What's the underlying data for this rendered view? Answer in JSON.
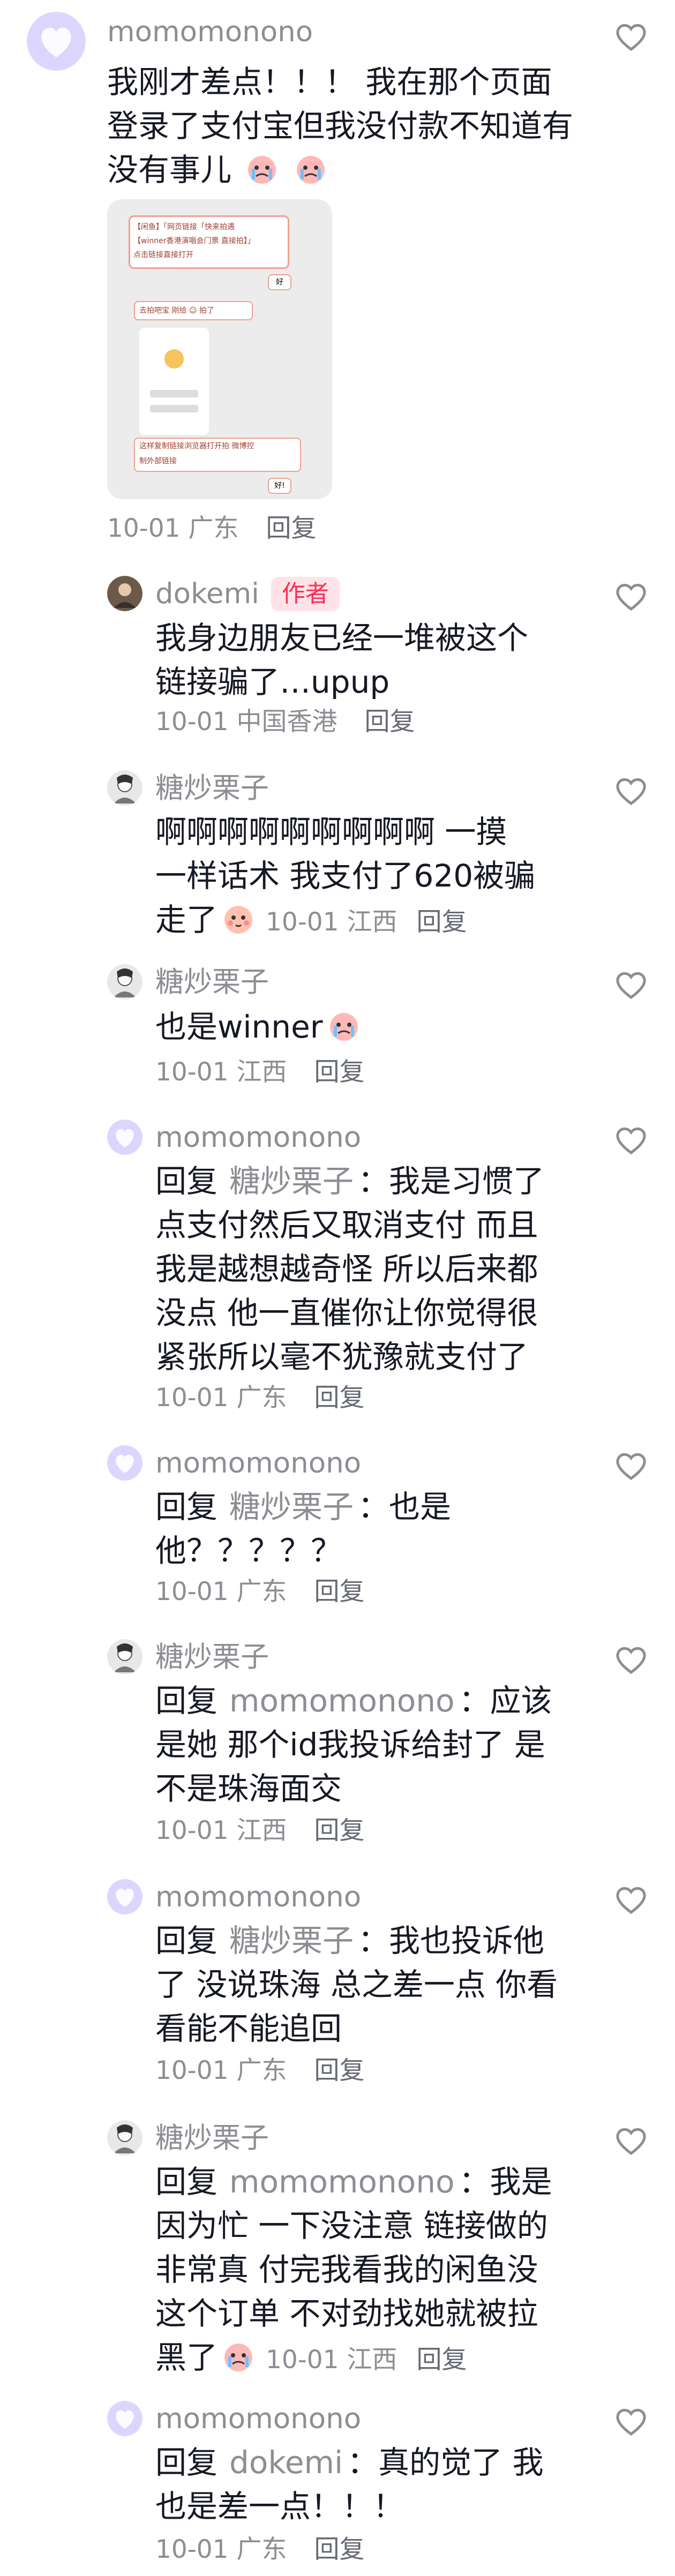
{
  "main_comment": {
    "user": "momomonono",
    "text": "我刚才差点！！！ 我在那个页面登录了支付宝但我没付款不知道有没有事儿",
    "date": "10-01",
    "region": "广东",
    "reply_label": "回复",
    "image": {
      "chat_lines": [
        "【闲鱼】「网页链接「快来拍遇",
        "【winner香港演唱会门票 直接拍】」",
        "点击链接直接打开",
        "好",
        "去拍吧宝 刚给 ☺ 拍了",
        "这样复制链接浏览器打开拍 微博控",
        "制外部链接",
        "好!"
      ]
    }
  },
  "replies": [
    {
      "user": "dokemi",
      "author_badge": "作者",
      "lines": [
        "我身边朋友已经一堆被这个",
        "链接骗了…upup"
      ],
      "date": "10-01",
      "region": "中国香港",
      "reply_label": "回复"
    },
    {
      "user": "糖炒栗子",
      "lines": [
        "啊啊啊啊啊啊啊啊啊 一摸",
        "一样话术  我支付了620被骗",
        "走了"
      ],
      "date": "10-01",
      "region": "江西",
      "reply_label": "回复"
    },
    {
      "user": "糖炒栗子",
      "lines": [
        "也是winner"
      ],
      "date": "10-01",
      "region": "江西",
      "reply_label": "回复"
    },
    {
      "user": "momomonono",
      "reply_prefix": "回复",
      "reply_to": "糖炒栗子",
      "lines": [
        "：我是习惯了",
        "点支付然后又取消支付 而且",
        "我是越想越奇怪 所以后来都",
        "没点 他一直催你让你觉得很",
        "紧张所以毫不犹豫就支付了"
      ],
      "date": "10-01",
      "region": "广东",
      "reply_label": "回复"
    },
    {
      "user": "momomonono",
      "reply_prefix": "回复",
      "reply_to": "糖炒栗子",
      "lines": [
        "：也是",
        "他？？？？？"
      ],
      "date": "10-01",
      "region": "广东",
      "reply_label": "回复"
    },
    {
      "user": "糖炒栗子",
      "reply_prefix": "回复",
      "reply_to": "momomonono",
      "lines": [
        "：应该",
        "是她 那个id我投诉给封了 是",
        "不是珠海面交"
      ],
      "date": "10-01",
      "region": "江西",
      "reply_label": "回复"
    },
    {
      "user": "momomonono",
      "reply_prefix": "回复",
      "reply_to": "糖炒栗子",
      "lines": [
        "：我也投诉他",
        "了 没说珠海 总之差一点 你看",
        "看能不能追回"
      ],
      "date": "10-01",
      "region": "广东",
      "reply_label": "回复"
    },
    {
      "user": "糖炒栗子",
      "reply_prefix": "回复",
      "reply_to": "momomonono",
      "lines": [
        "：我是",
        "因为忙 一下没注意 链接做的",
        "非常真 付完我看我的闲鱼没",
        "这个订单  不对劲找她就被拉",
        "黑了"
      ],
      "date": "10-01",
      "region": "江西",
      "reply_label": "回复"
    },
    {
      "user": "momomonono",
      "reply_prefix": "回复",
      "reply_to": "dokemi",
      "lines": [
        "：真的觉了 我",
        "也是差一点！！！"
      ],
      "date": "10-01",
      "region": "广东",
      "reply_label": "回复"
    }
  ],
  "colors": {
    "accent": "#fe2c55",
    "text": "#161823",
    "muted": "#8d8d93"
  }
}
